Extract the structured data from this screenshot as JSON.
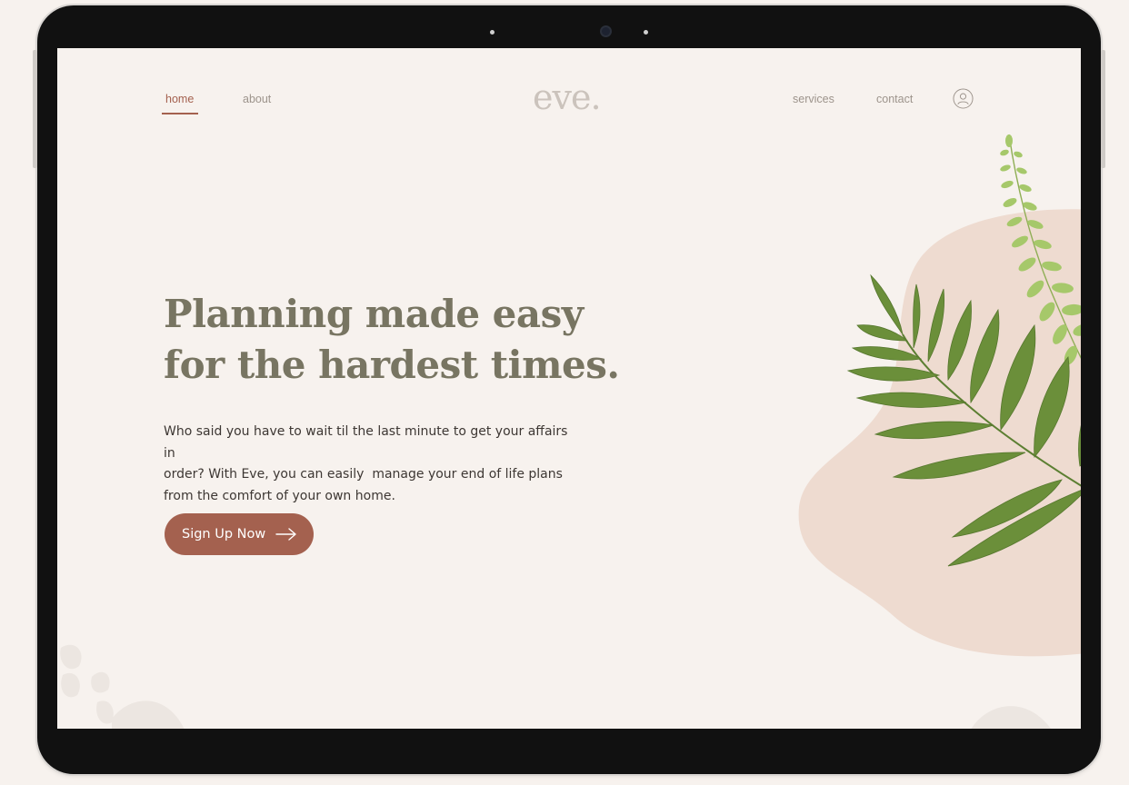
{
  "nav": {
    "left": [
      {
        "label": "home",
        "active": true
      },
      {
        "label": "about",
        "active": false
      }
    ],
    "logo": "eve.",
    "right": [
      {
        "label": "services"
      },
      {
        "label": "contact"
      }
    ],
    "account_icon": "user-circle-icon"
  },
  "hero": {
    "headline_line1": "Planning made easy",
    "headline_line2": "for the hardest times.",
    "body_line1": "Who said you have to wait til the last minute to get your affairs in",
    "body_line2": "order? With Eve, you can easily  manage your end of life plans",
    "body_line3": "from the comfort of your own home.",
    "cta_label": "Sign Up Now",
    "cta_icon": "arrow-right-icon"
  },
  "decor": {
    "illustration": "fern-leaves-illustration",
    "background_shape": "peach-blob"
  },
  "colors": {
    "background": "#f7f2ee",
    "accent": "#a4614f",
    "headline": "#787562",
    "body_text": "#3d3733",
    "blob": "#eedbd0",
    "leaf_dark": "#6b8f3a",
    "leaf_light": "#a6c86a"
  }
}
